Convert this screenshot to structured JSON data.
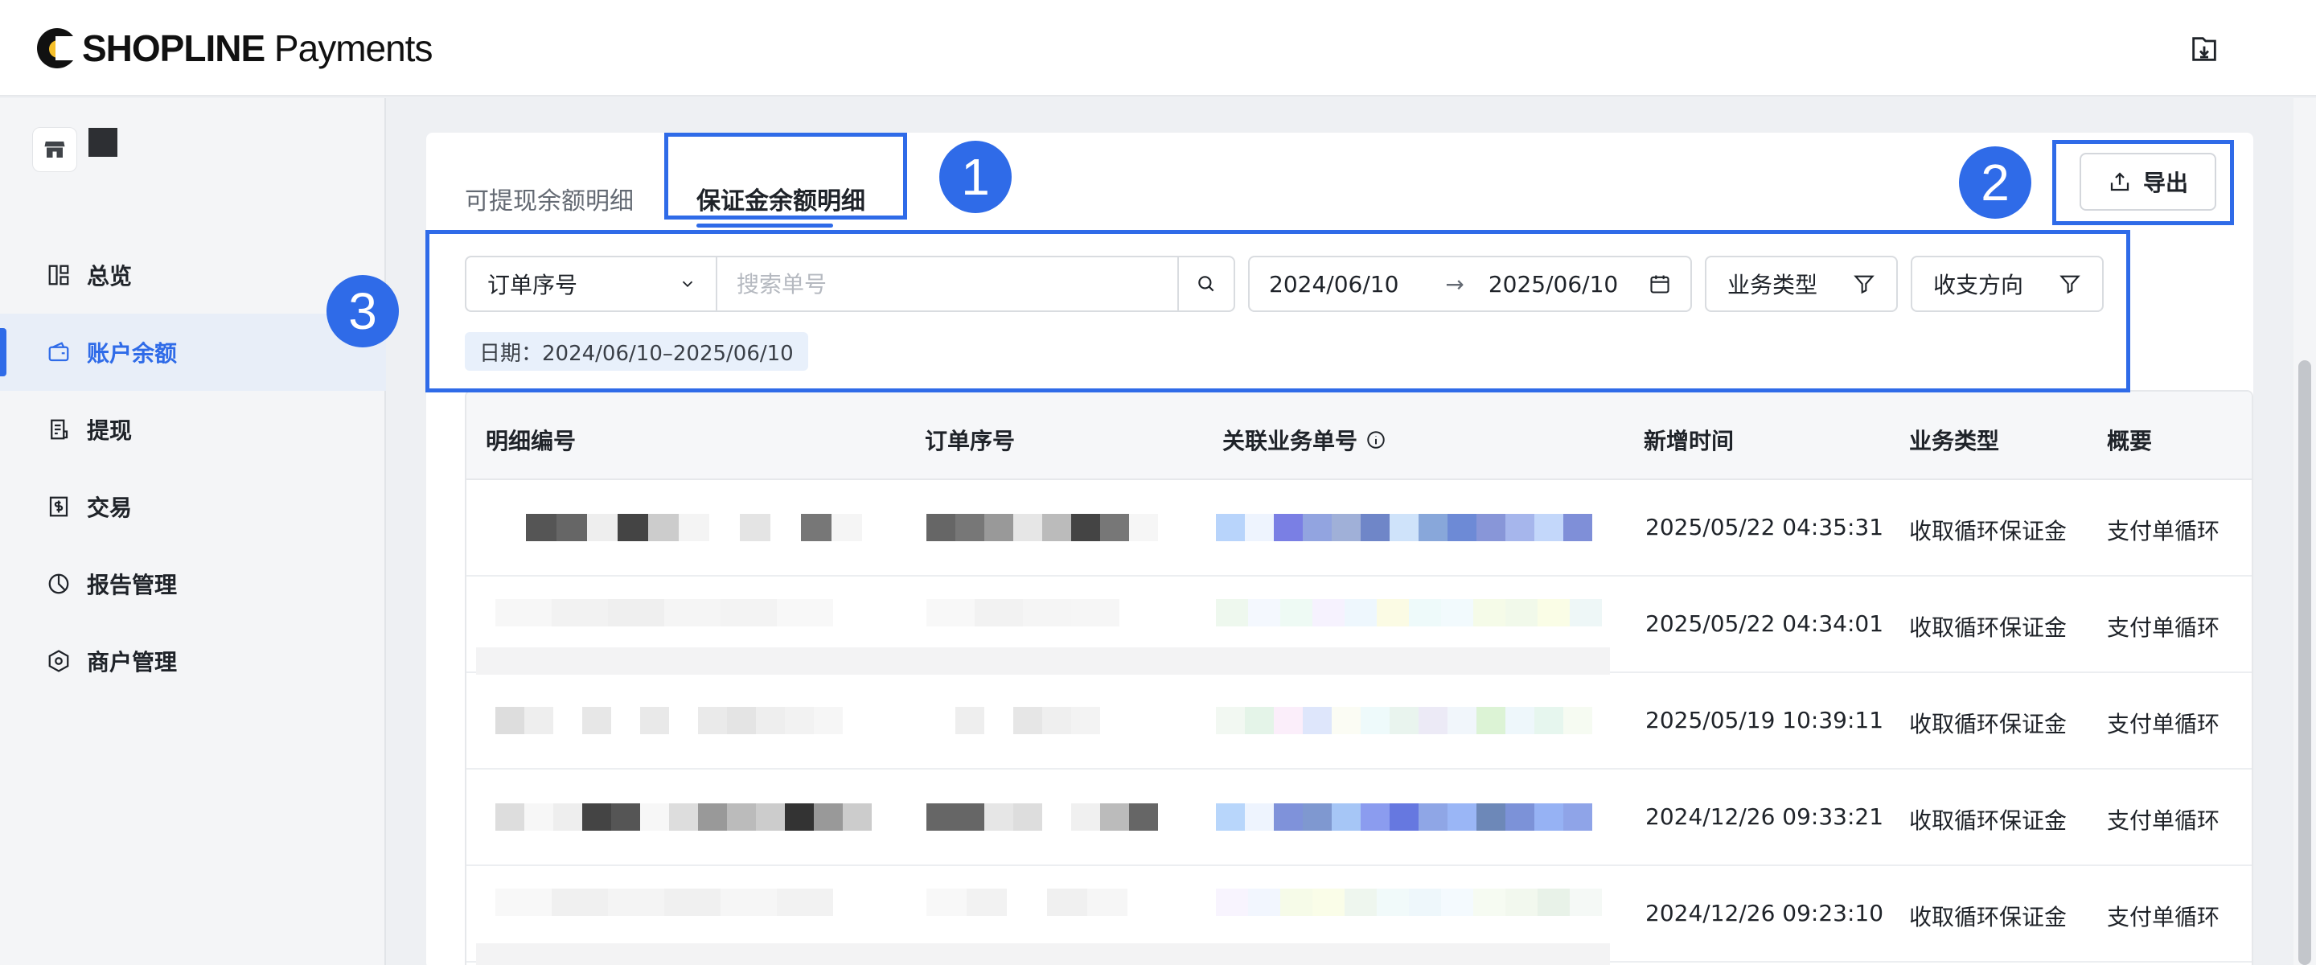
{
  "header": {
    "brand_strong": "SHOPLINE",
    "brand_light": " Payments"
  },
  "sidebar": {
    "items": [
      {
        "label": "总览",
        "icon": "dashboard-icon"
      },
      {
        "label": "账户余额",
        "icon": "wallet-icon",
        "active": true
      },
      {
        "label": "提现",
        "icon": "withdraw-icon"
      },
      {
        "label": "交易",
        "icon": "transaction-icon"
      },
      {
        "label": "报告管理",
        "icon": "report-icon"
      },
      {
        "label": "商户管理",
        "icon": "merchant-icon"
      }
    ]
  },
  "tabs": [
    {
      "label": "可提现余额明细",
      "active": false
    },
    {
      "label": "保证金余额明细",
      "active": true
    }
  ],
  "toolbar": {
    "export_label": "导出"
  },
  "filters": {
    "select_value": "订单序号",
    "search_placeholder": "搜索单号",
    "date_start": "2024/06/10",
    "date_arrow": "→",
    "date_end": "2025/06/10",
    "type_filter": "业务类型",
    "direction_filter": "收支方向",
    "date_tag": "日期：2024/06/10–2025/06/10"
  },
  "table": {
    "columns": [
      "明细编号",
      "订单序号",
      "关联业务单号",
      "新增时间",
      "业务类型",
      "概要"
    ],
    "rows": [
      {
        "time": "2025/05/22 04:35:31",
        "type": "收取循环保证金",
        "summary": "支付单循环"
      },
      {
        "time": "2025/05/22 04:34:01",
        "type": "收取循环保证金",
        "summary": "支付单循环"
      },
      {
        "time": "2025/05/19 10:39:11",
        "type": "收取循环保证金",
        "summary": "支付单循环"
      },
      {
        "time": "2024/12/26 09:33:21",
        "type": "收取循环保证金",
        "summary": "支付单循环"
      },
      {
        "time": "2024/12/26 09:23:10",
        "type": "收取循环保证金",
        "summary": "支付单循环"
      }
    ]
  },
  "annotations": [
    "1",
    "2",
    "3"
  ],
  "colors": {
    "accent": "#2f6be8",
    "text": "#1f2329",
    "muted": "#646a73"
  }
}
